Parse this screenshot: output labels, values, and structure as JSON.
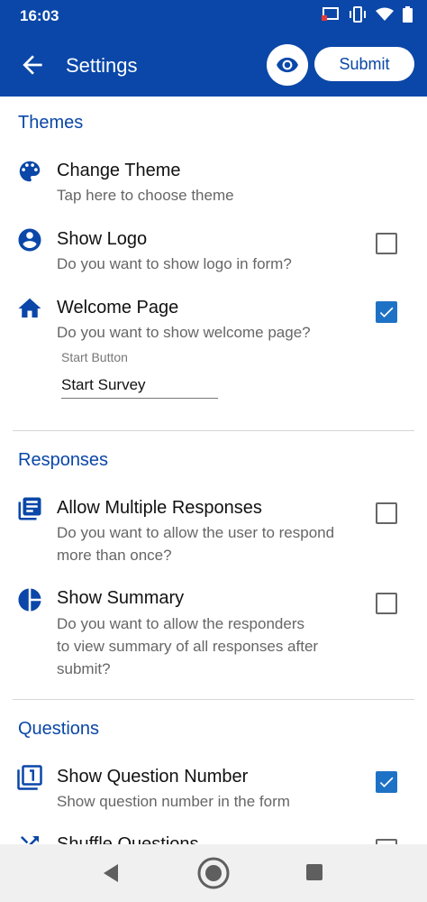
{
  "status_bar": {
    "time": "16:03"
  },
  "app_bar": {
    "title": "Settings",
    "submit_label": "Submit"
  },
  "sections": {
    "themes": {
      "title": "Themes",
      "change_theme": {
        "title": "Change Theme",
        "subtitle": "Tap here to choose theme"
      },
      "show_logo": {
        "title": "Show Logo",
        "subtitle": "Do you want to show logo in form?",
        "checked": false
      },
      "welcome_page": {
        "title": "Welcome Page",
        "subtitle": "Do you want to show welcome page?",
        "checked": true,
        "field_label": "Start Button",
        "field_value": "Start Survey"
      }
    },
    "responses": {
      "title": "Responses",
      "allow_multiple": {
        "title": "Allow Multiple Responses",
        "subtitle_line1": "Do you want to allow the user to respond",
        "subtitle_line2": "more than once?",
        "checked": false
      },
      "show_summary": {
        "title": "Show Summary",
        "subtitle_line1": "Do you want to allow the responders",
        "subtitle_line2": "to view summary of all responses after",
        "subtitle_line3": "submit?",
        "checked": false
      }
    },
    "questions": {
      "title": "Questions",
      "show_question_number": {
        "title": "Show Question Number",
        "subtitle": "Show question number in the form",
        "checked": true
      },
      "shuffle_questions": {
        "title": "Shuffle Questions",
        "checked": false
      }
    }
  },
  "colors": {
    "primary": "#0a47a8",
    "checkbox_checked": "#1e72c6"
  }
}
